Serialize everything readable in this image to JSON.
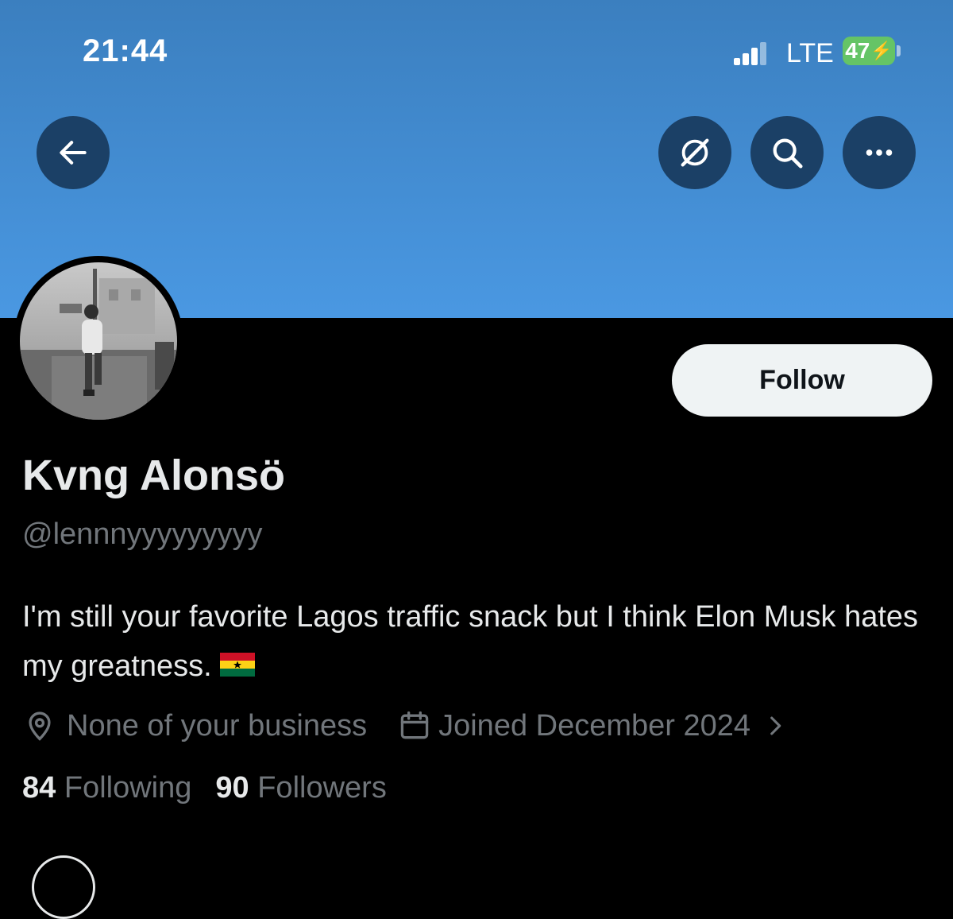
{
  "status_bar": {
    "time": "21:44",
    "network": "LTE",
    "battery": "47"
  },
  "header": {
    "icons": [
      "back-arrow-icon",
      "grok-icon",
      "search-icon",
      "more-icon"
    ],
    "button_color": "#1b4066",
    "banner_color": "#4a98e2"
  },
  "profile": {
    "follow_label": "Follow",
    "name": "Kvng Alonsö",
    "handle": "@lennnyyyyyyyyy",
    "bio": "I'm still your favorite Lagos traffic snack but I think Elon Musk hates my greatness.",
    "location": "None of your business",
    "joined": "Joined December 2024"
  },
  "stats": {
    "following_count": "84",
    "following_label": "Following",
    "followers_count": "90",
    "followers_label": "Followers"
  }
}
